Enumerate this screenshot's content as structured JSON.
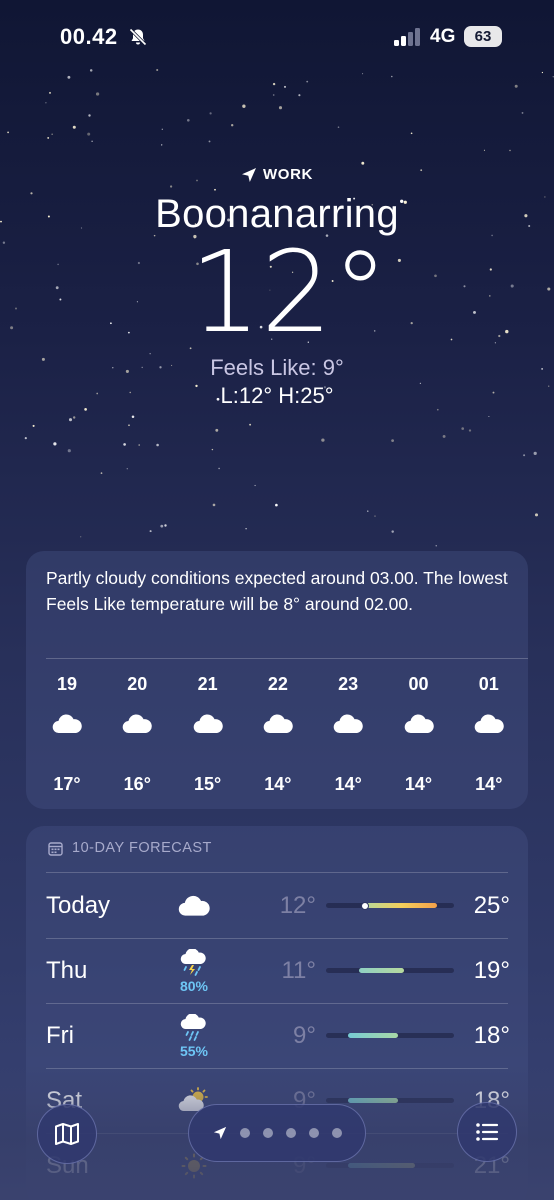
{
  "status_bar": {
    "time": "00.42",
    "network": "4G",
    "battery": "63"
  },
  "location": {
    "tag": "WORK",
    "city": "Boonanarring",
    "temperature": "12°",
    "feels_like": "Feels Like: 9°",
    "low_high": "L:12° H:25°"
  },
  "hourly": {
    "summary": "Partly cloudy conditions expected around 03.00. The lowest Feels Like temperature will be 8° around 02.00.",
    "hours": [
      {
        "time": "19",
        "icon": "cloud-icon",
        "temp": "17°"
      },
      {
        "time": "20",
        "icon": "cloud-icon",
        "temp": "16°"
      },
      {
        "time": "21",
        "icon": "cloud-icon",
        "temp": "15°"
      },
      {
        "time": "22",
        "icon": "cloud-icon",
        "temp": "14°"
      },
      {
        "time": "23",
        "icon": "cloud-icon",
        "temp": "14°"
      },
      {
        "time": "00",
        "icon": "cloud-icon",
        "temp": "14°"
      },
      {
        "time": "01",
        "icon": "cloud-icon",
        "temp": "14°"
      }
    ]
  },
  "forecast": {
    "header": "10-DAY FORECAST",
    "range_min": 5,
    "range_max": 28,
    "days": [
      {
        "day": "Today",
        "icon": "cloud-icon",
        "precip": "",
        "low": "12°",
        "high": "25°",
        "low_val": 12,
        "high_val": 25,
        "current_val": 12,
        "bar_color": "linear-gradient(90deg,#b7d89a,#f3cf5c,#f4a14a)"
      },
      {
        "day": "Thu",
        "icon": "thunderstorm-icon",
        "precip": "80%",
        "low": "11°",
        "high": "19°",
        "low_val": 11,
        "high_val": 19,
        "bar_color": "linear-gradient(90deg,#8fd0c3,#b6d99e)"
      },
      {
        "day": "Fri",
        "icon": "rain-cloud-icon",
        "precip": "55%",
        "low": "9°",
        "high": "18°",
        "low_val": 9,
        "high_val": 18,
        "bar_color": "linear-gradient(90deg,#77cbd4,#a8d8a6)"
      },
      {
        "day": "Sat",
        "icon": "partly-cloudy-sun-icon",
        "precip": "",
        "low": "9°",
        "high": "18°",
        "low_val": 9,
        "high_val": 18,
        "bar_color": "linear-gradient(90deg,#77cbd4,#a8d8a6)"
      },
      {
        "day": "Sun",
        "icon": "sun-icon",
        "precip": "",
        "low": "9°",
        "high": "21°",
        "low_val": 9,
        "high_val": 21,
        "bar_color": "linear-gradient(90deg,#77cbd4,#d8dc8a)"
      }
    ]
  },
  "colors": {
    "background_top": "#101634",
    "background_bottom": "#3a4476",
    "card": "#46508280",
    "precip_blue": "#6ec6f5"
  }
}
